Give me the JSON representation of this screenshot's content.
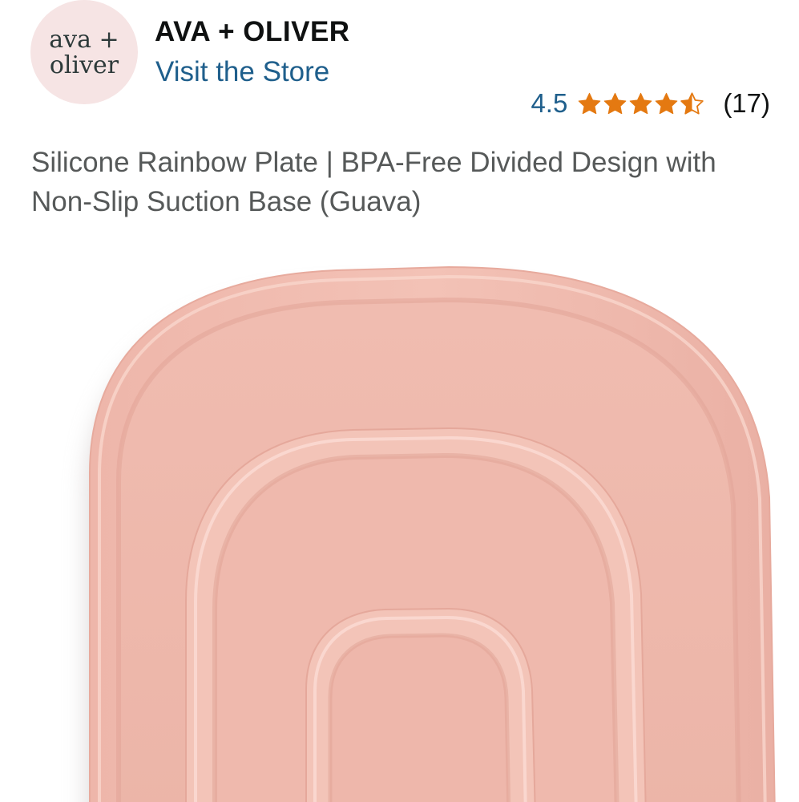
{
  "store": {
    "logo_line1": "ava +",
    "logo_line2": "oliver",
    "brand_name": "AVA + OLIVER",
    "visit_store_label": "Visit the Store"
  },
  "rating": {
    "value": "4.5",
    "stars": 4.5,
    "count": "(17)",
    "star_color": "#e47911"
  },
  "product": {
    "title": "Silicone Rainbow Plate | BPA-Free Divided Design with Non-Slip Suction Base (Guava)",
    "plate_color": "#f1bdb1"
  },
  "colors": {
    "link": "#1f5f8c",
    "title_text": "#565959",
    "brand_text": "#0f1111",
    "logo_bg": "#f6e4e4"
  }
}
